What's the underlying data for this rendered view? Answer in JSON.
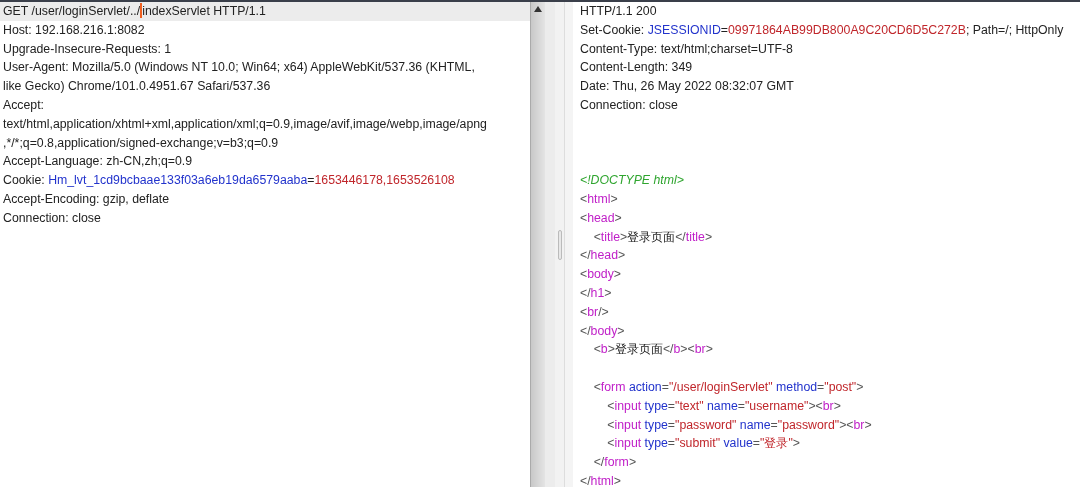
{
  "request": {
    "lines": [
      {
        "highlighted": true,
        "segments": [
          {
            "kind": "plain",
            "text": "GET /user/loginServlet/../"
          },
          {
            "kind": "cursor"
          },
          {
            "kind": "plain",
            "text": "indexServlet HTTP/1.1"
          }
        ]
      },
      {
        "highlighted": false,
        "segments": [
          {
            "kind": "plain",
            "text": "Host: 192.168.216.1:8082"
          }
        ]
      },
      {
        "highlighted": false,
        "segments": [
          {
            "kind": "plain",
            "text": "Upgrade-Insecure-Requests: 1"
          }
        ]
      },
      {
        "highlighted": false,
        "segments": [
          {
            "kind": "plain",
            "text": "User-Agent: Mozilla/5.0 (Windows NT 10.0; Win64; x64) AppleWebKit/537.36 (KHTML,"
          }
        ]
      },
      {
        "highlighted": false,
        "segments": [
          {
            "kind": "plain",
            "text": "like Gecko) Chrome/101.0.4951.67 Safari/537.36"
          }
        ]
      },
      {
        "highlighted": false,
        "segments": [
          {
            "kind": "plain",
            "text": "Accept:"
          }
        ]
      },
      {
        "highlighted": false,
        "segments": [
          {
            "kind": "plain",
            "text": "text/html,application/xhtml+xml,application/xml;q=0.9,image/avif,image/webp,image/apng"
          }
        ]
      },
      {
        "highlighted": false,
        "segments": [
          {
            "kind": "plain",
            "text": ",*/*;q=0.8,application/signed-exchange;v=b3;q=0.9"
          }
        ]
      },
      {
        "highlighted": false,
        "segments": [
          {
            "kind": "plain",
            "text": "Accept-Language: zh-CN,zh;q=0.9"
          }
        ]
      },
      {
        "highlighted": false,
        "segments": [
          {
            "kind": "plain",
            "text": "Cookie: "
          },
          {
            "kind": "name",
            "text": "Hm_lvt_1cd9bcbaae133f03a6eb19da6579aaba"
          },
          {
            "kind": "plain",
            "text": "="
          },
          {
            "kind": "value",
            "text": "1653446178,1653526108"
          }
        ]
      },
      {
        "highlighted": false,
        "segments": [
          {
            "kind": "plain",
            "text": "Accept-Encoding: gzip, deflate"
          }
        ]
      },
      {
        "highlighted": false,
        "segments": [
          {
            "kind": "plain",
            "text": "Connection: close"
          }
        ]
      }
    ]
  },
  "response": {
    "headers": [
      {
        "segments": [
          {
            "kind": "plain",
            "text": "HTTP/1.1 200"
          }
        ]
      },
      {
        "segments": [
          {
            "kind": "plain",
            "text": "Set-Cookie: "
          },
          {
            "kind": "name",
            "text": "JSESSIONID"
          },
          {
            "kind": "plain",
            "text": "="
          },
          {
            "kind": "value",
            "text": "09971864AB99DB800A9C20CD6D5C272B"
          },
          {
            "kind": "plain",
            "text": "; Path=/; HttpOnly"
          }
        ]
      },
      {
        "segments": [
          {
            "kind": "plain",
            "text": "Content-Type: text/html;charset=UTF-8"
          }
        ]
      },
      {
        "segments": [
          {
            "kind": "plain",
            "text": "Content-Length: 349"
          }
        ]
      },
      {
        "segments": [
          {
            "kind": "plain",
            "text": "Date: Thu, 26 May 2022 08:32:07 GMT"
          }
        ]
      },
      {
        "segments": [
          {
            "kind": "plain",
            "text": "Connection: close"
          }
        ]
      }
    ],
    "body": [
      {
        "segments": [
          {
            "kind": "doctype",
            "text": "<!DOCTYPE html>"
          }
        ]
      },
      {
        "segments": [
          {
            "kind": "punct",
            "text": "<"
          },
          {
            "kind": "tag",
            "text": "html"
          },
          {
            "kind": "punct",
            "text": ">"
          }
        ]
      },
      {
        "segments": [
          {
            "kind": "punct",
            "text": "<"
          },
          {
            "kind": "tag",
            "text": "head"
          },
          {
            "kind": "punct",
            "text": ">"
          }
        ]
      },
      {
        "segments": [
          {
            "kind": "punct",
            "text": "    <"
          },
          {
            "kind": "tag",
            "text": "title"
          },
          {
            "kind": "punct",
            "text": ">"
          },
          {
            "kind": "cjk",
            "text": "登录页面"
          },
          {
            "kind": "punct",
            "text": "</"
          },
          {
            "kind": "tag",
            "text": "title"
          },
          {
            "kind": "punct",
            "text": ">"
          }
        ]
      },
      {
        "segments": [
          {
            "kind": "punct",
            "text": "</"
          },
          {
            "kind": "tag",
            "text": "head"
          },
          {
            "kind": "punct",
            "text": ">"
          }
        ]
      },
      {
        "segments": [
          {
            "kind": "punct",
            "text": "<"
          },
          {
            "kind": "tag",
            "text": "body"
          },
          {
            "kind": "punct",
            "text": ">"
          }
        ]
      },
      {
        "segments": [
          {
            "kind": "punct",
            "text": "</"
          },
          {
            "kind": "tag",
            "text": "h1"
          },
          {
            "kind": "punct",
            "text": ">"
          }
        ]
      },
      {
        "segments": [
          {
            "kind": "punct",
            "text": "<"
          },
          {
            "kind": "tag",
            "text": "br"
          },
          {
            "kind": "punct",
            "text": "/>"
          }
        ]
      },
      {
        "segments": [
          {
            "kind": "punct",
            "text": "</"
          },
          {
            "kind": "tag",
            "text": "body"
          },
          {
            "kind": "punct",
            "text": ">"
          }
        ]
      },
      {
        "segments": [
          {
            "kind": "punct",
            "text": "    <"
          },
          {
            "kind": "tag",
            "text": "b"
          },
          {
            "kind": "punct",
            "text": ">"
          },
          {
            "kind": "cjk",
            "text": "登录页面"
          },
          {
            "kind": "punct",
            "text": "</"
          },
          {
            "kind": "tag",
            "text": "b"
          },
          {
            "kind": "punct",
            "text": "><"
          },
          {
            "kind": "tag",
            "text": "br"
          },
          {
            "kind": "punct",
            "text": ">"
          }
        ]
      },
      {
        "blank_line_before": true,
        "segments": [
          {
            "kind": "punct",
            "text": "    <"
          },
          {
            "kind": "tag",
            "text": "form"
          },
          {
            "kind": "attr",
            "text": " action"
          },
          {
            "kind": "punct",
            "text": "="
          },
          {
            "kind": "str",
            "text": "\"/user/loginServlet\""
          },
          {
            "kind": "attr",
            "text": " method"
          },
          {
            "kind": "punct",
            "text": "="
          },
          {
            "kind": "str",
            "text": "\"post\""
          },
          {
            "kind": "punct",
            "text": ">"
          }
        ]
      },
      {
        "segments": [
          {
            "kind": "punct",
            "text": "        <"
          },
          {
            "kind": "tag",
            "text": "input"
          },
          {
            "kind": "attr",
            "text": " type"
          },
          {
            "kind": "punct",
            "text": "="
          },
          {
            "kind": "str",
            "text": "\"text\""
          },
          {
            "kind": "attr",
            "text": " name"
          },
          {
            "kind": "punct",
            "text": "="
          },
          {
            "kind": "str",
            "text": "\"username\""
          },
          {
            "kind": "punct",
            "text": "><"
          },
          {
            "kind": "tag",
            "text": "br"
          },
          {
            "kind": "punct",
            "text": ">"
          }
        ]
      },
      {
        "segments": [
          {
            "kind": "punct",
            "text": "        <"
          },
          {
            "kind": "tag",
            "text": "input"
          },
          {
            "kind": "attr",
            "text": " type"
          },
          {
            "kind": "punct",
            "text": "="
          },
          {
            "kind": "str",
            "text": "\"password\""
          },
          {
            "kind": "attr",
            "text": " name"
          },
          {
            "kind": "punct",
            "text": "="
          },
          {
            "kind": "str",
            "text": "\"password\""
          },
          {
            "kind": "punct",
            "text": "><"
          },
          {
            "kind": "tag",
            "text": "br"
          },
          {
            "kind": "punct",
            "text": ">"
          }
        ]
      },
      {
        "segments": [
          {
            "kind": "punct",
            "text": "        <"
          },
          {
            "kind": "tag",
            "text": "input"
          },
          {
            "kind": "attr",
            "text": " type"
          },
          {
            "kind": "punct",
            "text": "="
          },
          {
            "kind": "str",
            "text": "\"submit\""
          },
          {
            "kind": "attr",
            "text": " value"
          },
          {
            "kind": "punct",
            "text": "="
          },
          {
            "kind": "str",
            "text": "\"登录\""
          },
          {
            "kind": "punct",
            "text": ">"
          }
        ]
      },
      {
        "segments": [
          {
            "kind": "punct",
            "text": "    </"
          },
          {
            "kind": "tag",
            "text": "form"
          },
          {
            "kind": "punct",
            "text": ">"
          }
        ]
      },
      {
        "segments": [
          {
            "kind": "punct",
            "text": "</"
          },
          {
            "kind": "tag",
            "text": "html"
          },
          {
            "kind": "punct",
            "text": ">"
          }
        ]
      }
    ]
  }
}
